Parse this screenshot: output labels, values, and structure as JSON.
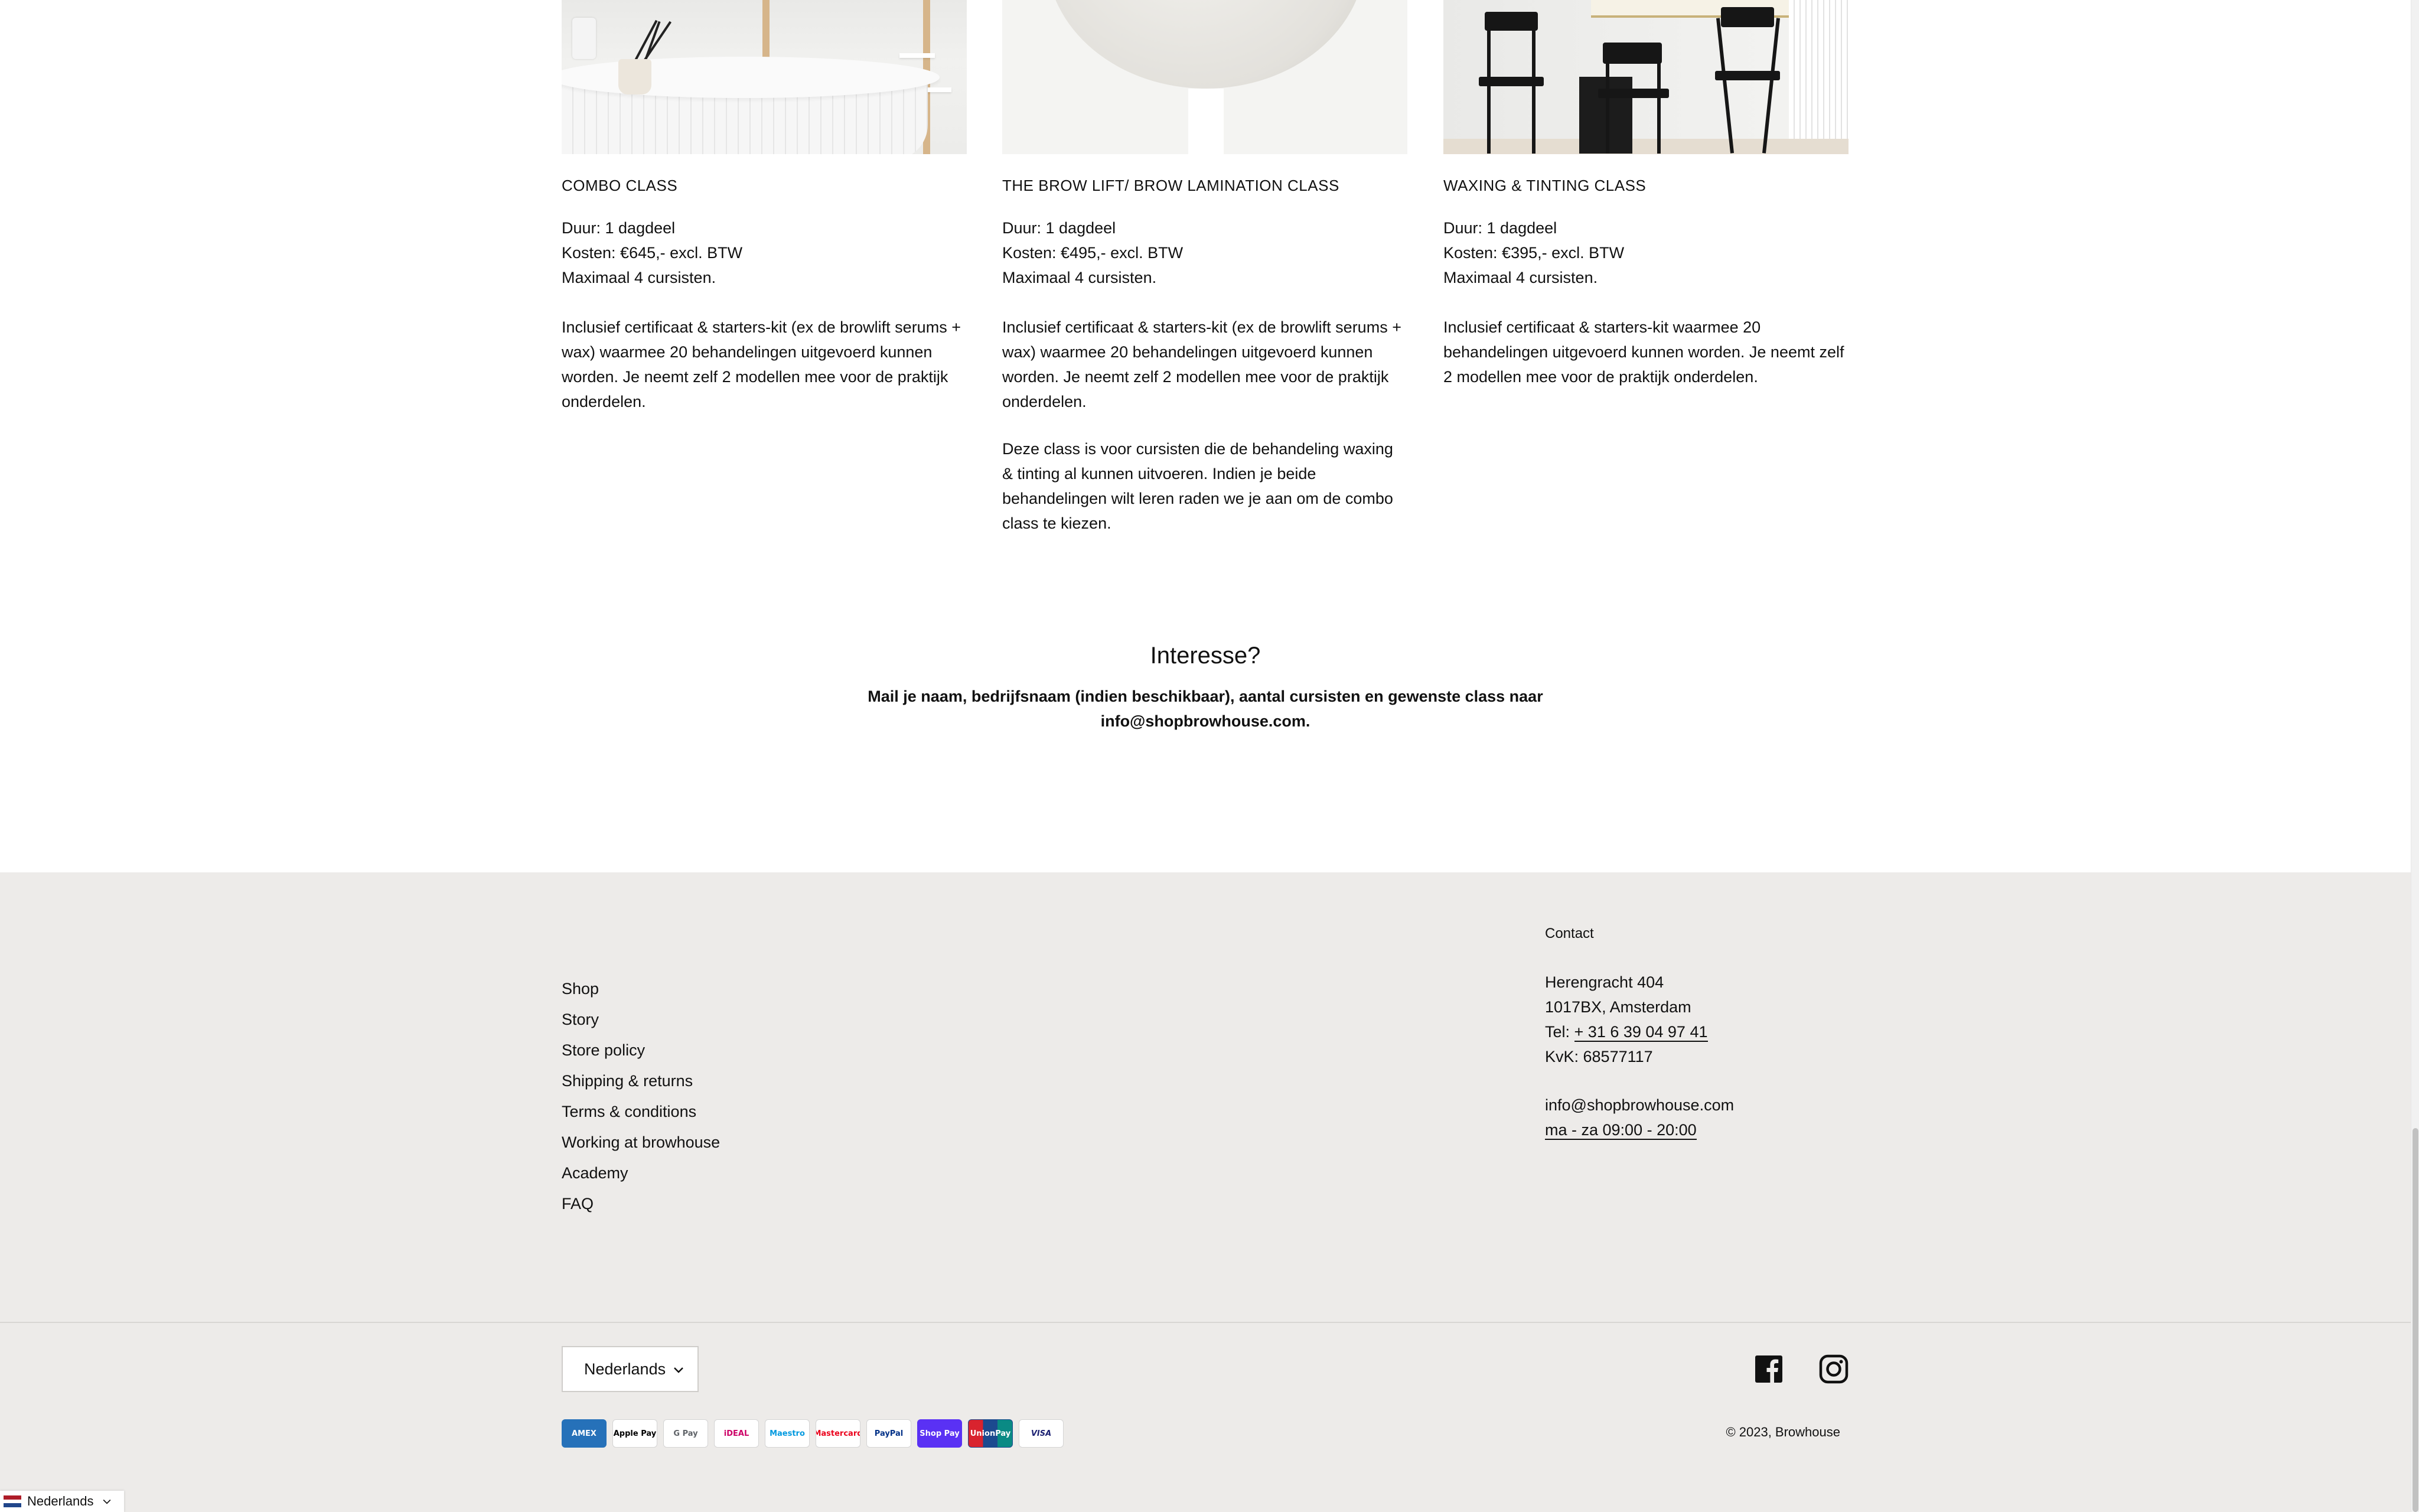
{
  "classes": [
    {
      "image_alt": "white round counter with brushes",
      "title": "COMBO CLASS",
      "duration": "Duur: 1 dagdeel",
      "cost": "Kosten: €645,- excl. BTW",
      "max": "Maximaal 4 cursisten.",
      "desc": "Inclusief certificaat & starters-kit (ex de browlift serums + wax) waarmee 20 behandelingen uitgevoerd kunnen worden. Je neemt zelf 2 modellen mee voor de praktijk onderdelen.",
      "note": ""
    },
    {
      "image_alt": "paper lamp",
      "title": "THE BROW LIFT/ BROW LAMINATION CLASS",
      "duration": "Duur: 1 dagdeel",
      "cost": "Kosten: €495,- excl. BTW",
      "max": "Maximaal 4 cursisten.",
      "desc": "Inclusief certificaat & starters-kit (ex de browlift serums + wax) waarmee 20 behandelingen uitgevoerd kunnen worden. Je neemt zelf 2 modellen mee voor de praktijk onderdelen.",
      "note": "Deze class is voor cursisten die de behandeling waxing & tinting al kunnen uitvoeren. Indien je beide behandelingen wilt leren raden we je aan om de combo class te kiezen."
    },
    {
      "image_alt": "black bar stools",
      "title": "WAXING & TINTING CLASS",
      "duration": "Duur: 1 dagdeel",
      "cost": "Kosten: €395,- excl. BTW",
      "max": "Maximaal 4 cursisten.",
      "desc": "Inclusief certificaat & starters-kit waarmee 20 behandelingen uitgevoerd kunnen worden. Je neemt zelf 2 modellen mee voor de praktijk onderdelen.",
      "note": ""
    }
  ],
  "interest": {
    "title": "Interesse?",
    "text": "Mail je naam, bedrijfsnaam (indien beschikbaar), aantal cursisten en gewenste class naar info@shopbrowhouse.com."
  },
  "footer": {
    "nav": [
      "Shop",
      "Story",
      "Store policy",
      "Shipping & returns",
      "Terms & conditions",
      "Working at browhouse",
      "Academy",
      "FAQ"
    ],
    "contact": {
      "heading": "Contact",
      "address1": "Herengracht 404",
      "address2": "1017BX, Amsterdam",
      "tel_label": "Tel: ",
      "tel": "+ 31 6 39 04 97 41",
      "kvk": "KvK: 68577117",
      "email": "info@shopbrowhouse.com",
      "hours": "ma - za 09:00 - 20:00"
    },
    "language": "Nederlands",
    "payments": [
      "AMEX",
      "Apple Pay",
      "G Pay",
      "iDEAL",
      "Maestro",
      "Mastercard",
      "PayPal",
      "Shop Pay",
      "UnionPay",
      "VISA"
    ],
    "copyright": "© 2023, Browhouse"
  },
  "icons": [
    "facebook-icon",
    "instagram-icon",
    "chevron-down-icon",
    "flag-nl-icon"
  ],
  "colors": {
    "footer_bg": "#edebe9",
    "text": "#111111",
    "amex": "#2671b9",
    "shoppay": "#5a31f4",
    "visa": "#1a1f71"
  },
  "lang_widget": {
    "label": "Nederlands"
  }
}
